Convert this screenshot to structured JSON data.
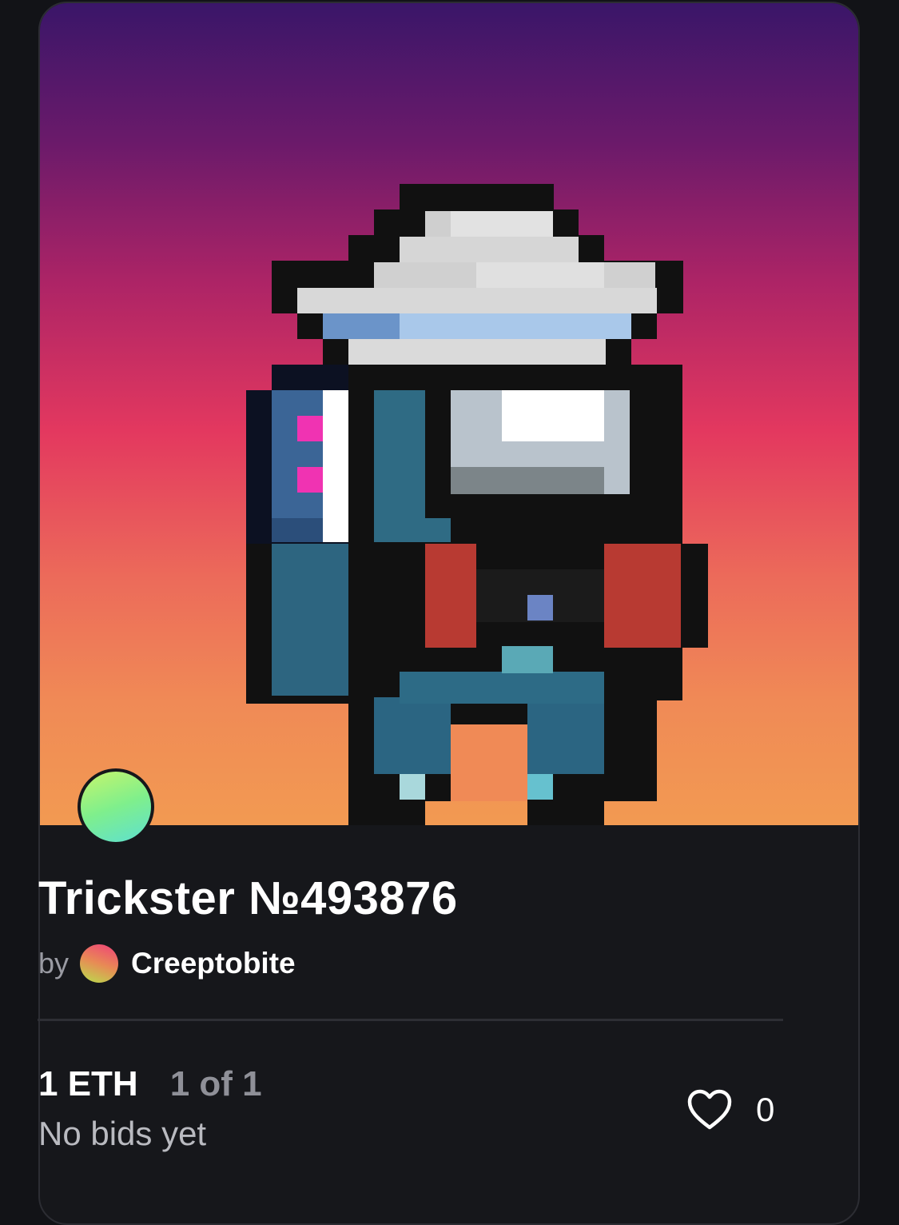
{
  "artwork": {
    "title": "Trickster №493876",
    "image_icon": "pixel-art-astronaut",
    "gradient_colors": [
      "#3a1669",
      "#ad2466",
      "#e3385f",
      "#f29a52"
    ]
  },
  "owner": {
    "avatar_icon": "owner-avatar-gradient"
  },
  "creator": {
    "by_label": "by",
    "name": "Creeptobite",
    "avatar_icon": "creator-avatar-gradient"
  },
  "sale": {
    "price": "1 ETH",
    "edition": "1 of 1",
    "bid_status": "No bids yet"
  },
  "likes": {
    "icon": "heart-icon",
    "count": "0"
  }
}
